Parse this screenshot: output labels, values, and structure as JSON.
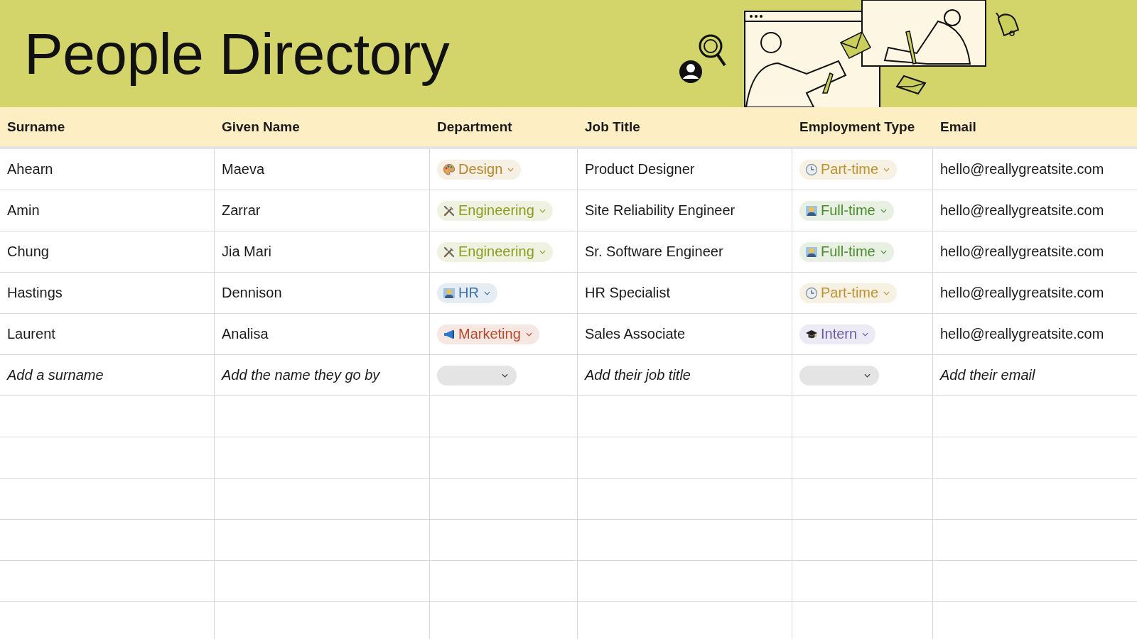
{
  "title": "People Directory",
  "table": {
    "columns": [
      "Surname",
      "Given Name",
      "Department",
      "Job Title",
      "Employment Type",
      "Email"
    ],
    "rows": [
      {
        "surname": "Ahearn",
        "given_name": "Maeva",
        "department": {
          "label": "Design",
          "kind": "palette",
          "color": "#b8862a"
        },
        "job_title": "Product Designer",
        "employment_type": {
          "label": "Part-time",
          "kind": "clock",
          "color": "#c0922e"
        },
        "email": "hello@reallygreatsite.com"
      },
      {
        "surname": "Amin",
        "given_name": "Zarrar",
        "department": {
          "label": "Engineering",
          "kind": "tools",
          "color": "#8c9c1c"
        },
        "job_title": "Site Reliability Engineer",
        "employment_type": {
          "label": "Full-time",
          "kind": "person",
          "color": "#4a8a2a"
        },
        "email": "hello@reallygreatsite.com"
      },
      {
        "surname": "Chung",
        "given_name": "Jia Mari",
        "department": {
          "label": "Engineering",
          "kind": "tools",
          "color": "#8c9c1c"
        },
        "job_title": "Sr. Software Engineer",
        "employment_type": {
          "label": "Full-time",
          "kind": "person",
          "color": "#4a8a2a"
        },
        "email": "hello@reallygreatsite.com"
      },
      {
        "surname": "Hastings",
        "given_name": "Dennison",
        "department": {
          "label": "HR",
          "kind": "person",
          "color": "#3d6fa6"
        },
        "job_title": "HR Specialist",
        "employment_type": {
          "label": "Part-time",
          "kind": "clock",
          "color": "#c0922e"
        },
        "email": "hello@reallygreatsite.com"
      },
      {
        "surname": "Laurent",
        "given_name": "Analisa",
        "department": {
          "label": "Marketing",
          "kind": "megaphone",
          "color": "#b8482a"
        },
        "job_title": "Sales Associate",
        "employment_type": {
          "label": "Intern",
          "kind": "cap",
          "color": "#6a5aa8"
        },
        "email": "hello@reallygreatsite.com"
      }
    ],
    "new_row": {
      "surname": "Add a surname",
      "given_name": "Add the name they go by",
      "job_title": "Add their job title",
      "email": "Add their email"
    }
  }
}
